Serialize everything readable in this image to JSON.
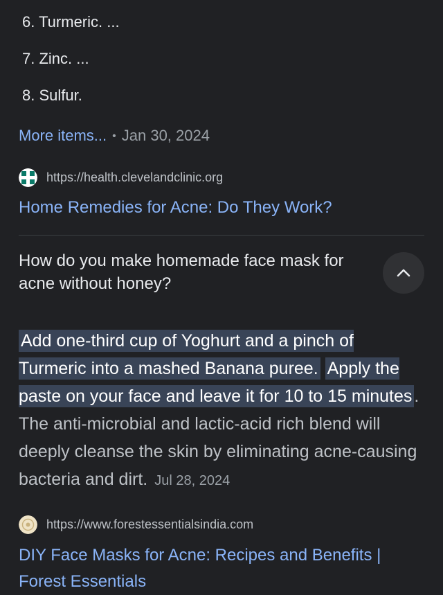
{
  "list_items": [
    "6. Turmeric. ...",
    "7. Zinc. ...",
    "8. Sulfur."
  ],
  "more_items": "More items...",
  "separator": "•",
  "result1": {
    "date": "Jan 30, 2024",
    "url": "https://health.clevelandclinic.org",
    "title": "Home Remedies for Acne: Do They Work?"
  },
  "faq": {
    "question": "How do you make homemade face mask for acne without honey?",
    "toggle_icon": "chevron-up-icon",
    "answer_highlight_1": "Add one-third cup of Yoghurt and a pinch of Turmeric into a mashed Banana puree.",
    "answer_highlight_2": "Apply the paste on your face and leave it for 10 to 15 minutes",
    "answer_rest": ". The anti-microbial and lactic-acid rich blend will deeply cleanse the skin by eliminating acne-causing bacteria and dirt.",
    "answer_date": "Jul 28, 2024"
  },
  "result2": {
    "url": "https://www.forestessentialsindia.com",
    "title": "DIY Face Masks for Acne: Recipes and Benefits | Forest Essentials"
  },
  "colors": {
    "background": "#202124",
    "link": "#8ab4f8",
    "highlight": "#394457"
  }
}
